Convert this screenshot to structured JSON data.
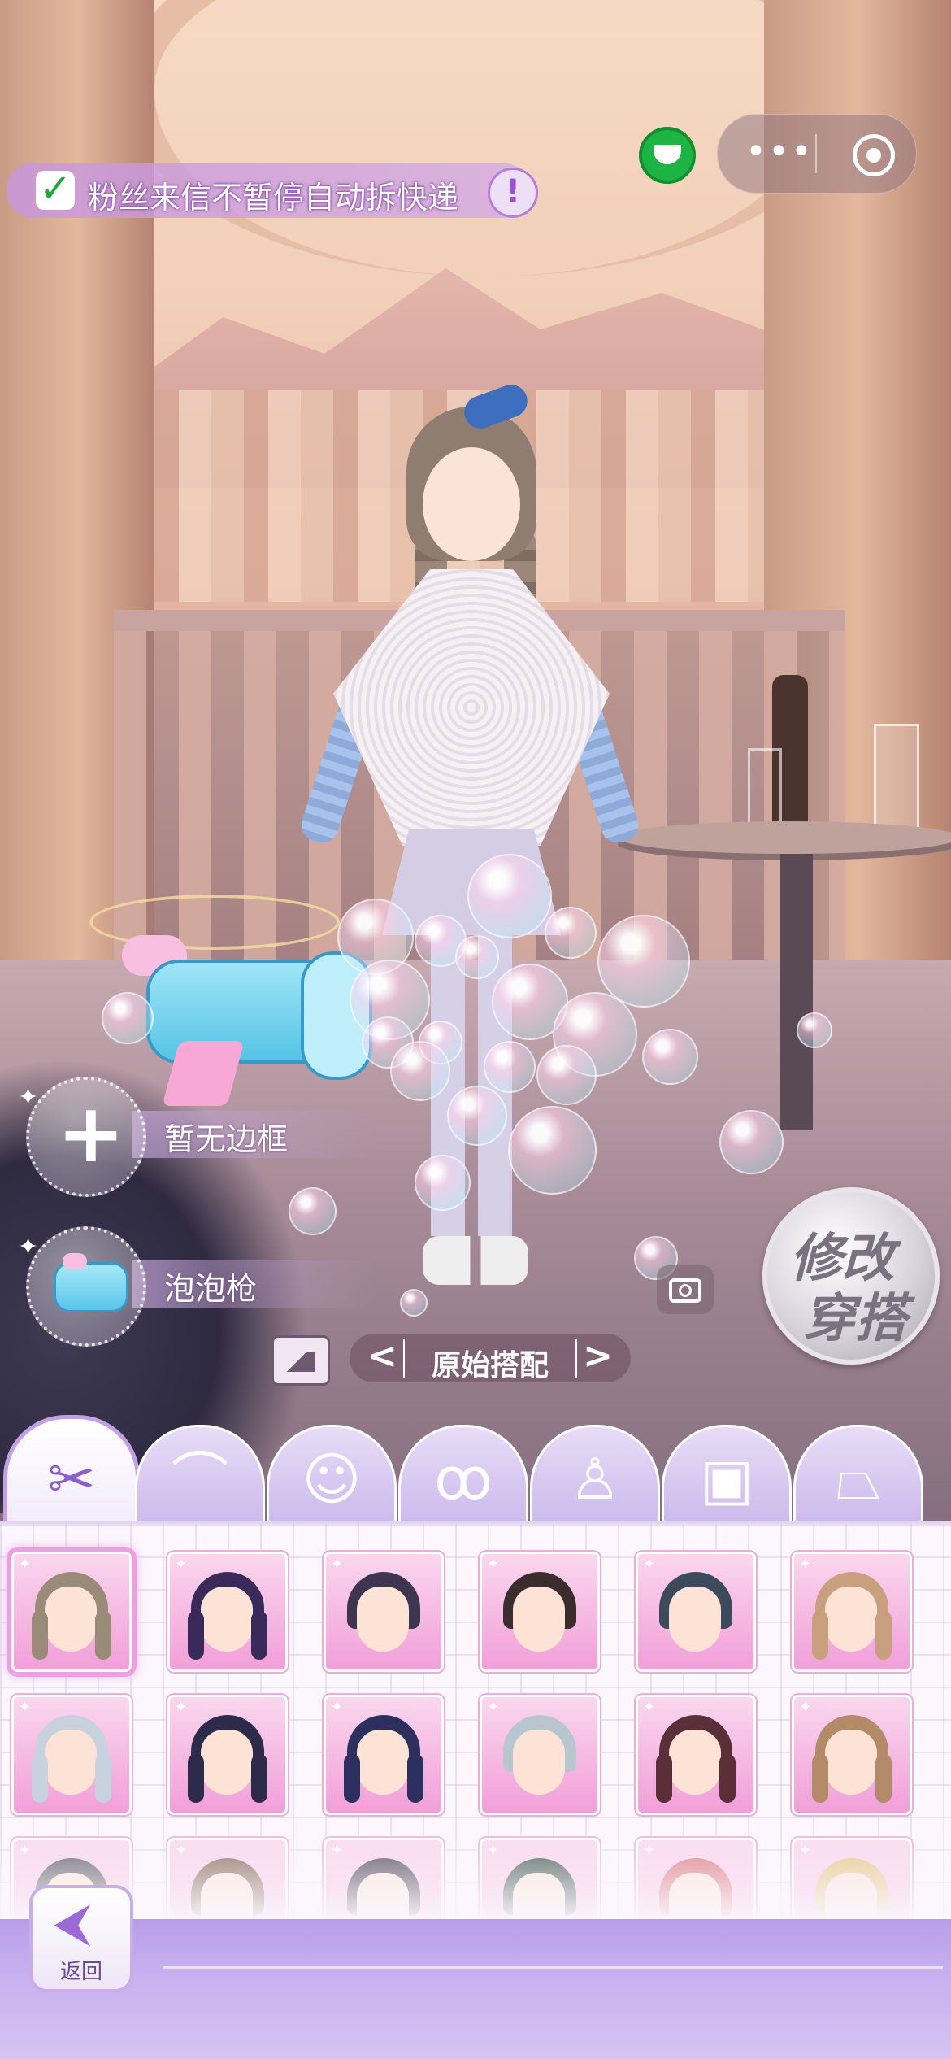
{
  "auto_unbox": {
    "checked": true,
    "label": "粉丝来信不暂停自动拆快递",
    "info_icon": "exclamation-icon"
  },
  "mini_program": {
    "menu_icon": "more-dots-icon",
    "close_icon": "target-circle-icon"
  },
  "slots": {
    "frame_label": "暂无边框",
    "prop_label": "泡泡枪"
  },
  "outfit": {
    "prev": "<",
    "next": ">",
    "name": "原始搭配"
  },
  "modify_button": {
    "line1": "修改",
    "line2": "穿搭"
  },
  "category_tabs": [
    {
      "icon": "scissors-icon",
      "active": true
    },
    {
      "icon": "hat-icon",
      "active": false
    },
    {
      "icon": "face-icon",
      "active": false
    },
    {
      "icon": "earrings-icon",
      "active": false
    },
    {
      "icon": "dress-icon",
      "active": false
    },
    {
      "icon": "shirt-icon",
      "active": false
    },
    {
      "icon": "skirt-icon",
      "active": false
    }
  ],
  "hair_items": [
    {
      "color": "#9a8a78",
      "style": "braids",
      "selected": true
    },
    {
      "color": "#3a2a5a",
      "style": "long"
    },
    {
      "color": "#3e3550",
      "style": "twin-buns"
    },
    {
      "color": "#3b2c2e",
      "style": "bob"
    },
    {
      "color": "#3d4a5c",
      "style": "bob"
    },
    {
      "color": "#c9a07e",
      "style": "braids"
    },
    {
      "color": "#c7d2de",
      "style": "twintails"
    },
    {
      "color": "#2e2a4a",
      "style": "long"
    },
    {
      "color": "#2d2f5e",
      "style": "long-red-tips"
    },
    {
      "color": "#b8c6cf",
      "style": "bob"
    },
    {
      "color": "#5b2f38",
      "style": "long"
    },
    {
      "color": "#b48b68",
      "style": "long"
    },
    {
      "color": "#4a4a55",
      "style": "short"
    },
    {
      "color": "#7a5845",
      "style": "short"
    },
    {
      "color": "#3b3344",
      "style": "short"
    },
    {
      "color": "#2f4a40",
      "style": "short"
    },
    {
      "color": "#d86c72",
      "style": "short"
    },
    {
      "color": "#e2c077",
      "style": "short"
    }
  ],
  "back_button": {
    "label": "返回"
  }
}
